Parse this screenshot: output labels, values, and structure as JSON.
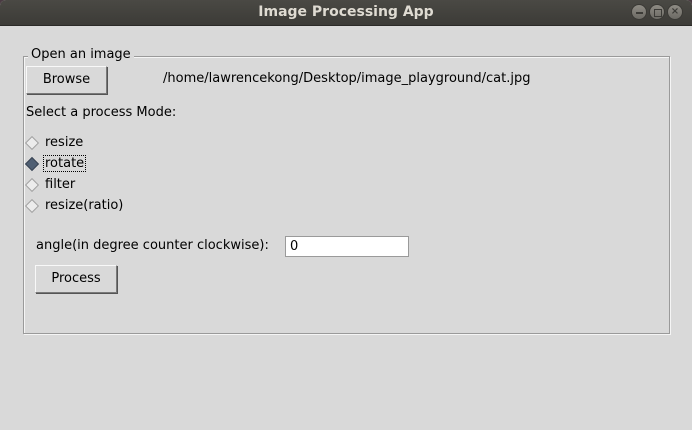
{
  "window": {
    "title": "Image Processing App"
  },
  "open_group": {
    "legend": "Open an image",
    "browse_label": "Browse",
    "file_path": "/home/lawrencekong/Desktop/image_playground/cat.jpg"
  },
  "mode": {
    "label": "Select a process Mode:",
    "options": [
      {
        "label": "resize",
        "selected": false
      },
      {
        "label": "rotate",
        "selected": true
      },
      {
        "label": "filter",
        "selected": false
      },
      {
        "label": "resize(ratio)",
        "selected": false
      }
    ],
    "selected_value": "rotate"
  },
  "angle": {
    "label": "angle(in degree counter clockwise):",
    "value": "0"
  },
  "process_label": "Process",
  "colors": {
    "window_bg": "#d9d9d9",
    "titlebar_bg": "#3c3b37",
    "radio_selected": "#4f5f73"
  }
}
